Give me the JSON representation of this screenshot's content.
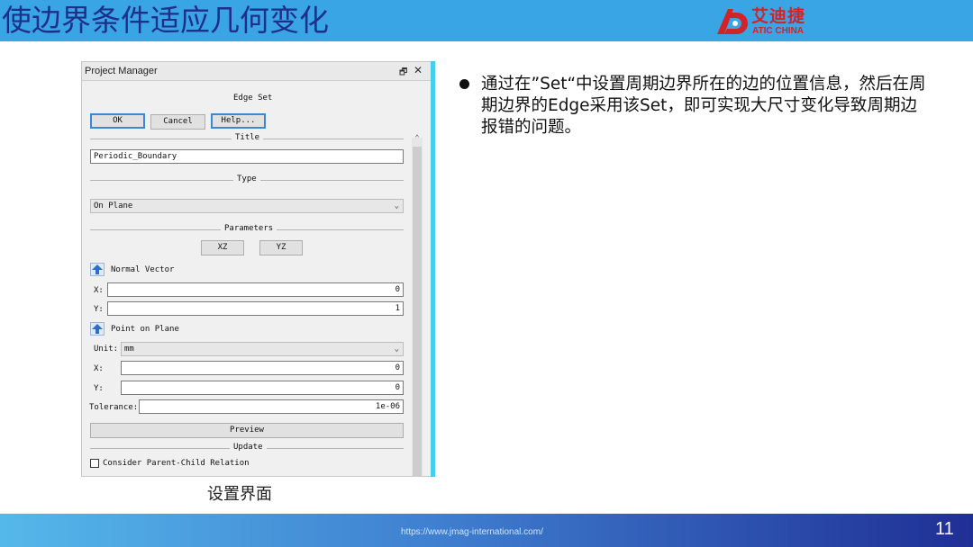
{
  "slide": {
    "title": "使边界条件适应几何变化",
    "logo_cn": "艾迪捷",
    "logo_en": "ATIC CHINA",
    "bullet": "通过在”Set“中设置周期边界所在的边的位置信息，然后在周期边界的Edge采用该Set，即可实现大尺寸变化导致周期边报错的问题。",
    "caption": "设置界面",
    "footer_url_prefix": "https://",
    "footer_url": "www.jmag-international.com/",
    "page_number": "11"
  },
  "dialog": {
    "panel_title": "Project Manager",
    "pin_icon": "🗗",
    "close_icon": "✕",
    "heading": "Edge Set",
    "ok_label": "OK",
    "cancel_label": "Cancel",
    "help_label": "Help...",
    "title_section": "Title",
    "title_value": "Periodic_Boundary",
    "type_section": "Type",
    "type_value": "On Plane",
    "parameters_section": "Parameters",
    "xz_label": "XZ",
    "yz_label": "YZ",
    "normal_vector_label": "Normal Vector",
    "nv_x_label": "X:",
    "nv_x_value": "0",
    "nv_y_label": "Y:",
    "nv_y_value": "1",
    "point_on_plane_label": "Point on Plane",
    "unit_label": "Unit:",
    "unit_value": "mm",
    "pp_x_label": "X:",
    "pp_x_value": "0",
    "pp_y_label": "Y:",
    "pp_y_value": "0",
    "tolerance_label": "Tolerance:",
    "tolerance_value": "1e-06",
    "preview_label": "Preview",
    "update_section": "Update",
    "consider_label": "Consider Parent-Child Relation",
    "consider_checked": false
  },
  "colors": {
    "title_bar": "#3aa5e4",
    "title_text": "#1e2f8a",
    "brand_red": "#d0232a",
    "accent_cyan": "#40d0f0"
  }
}
